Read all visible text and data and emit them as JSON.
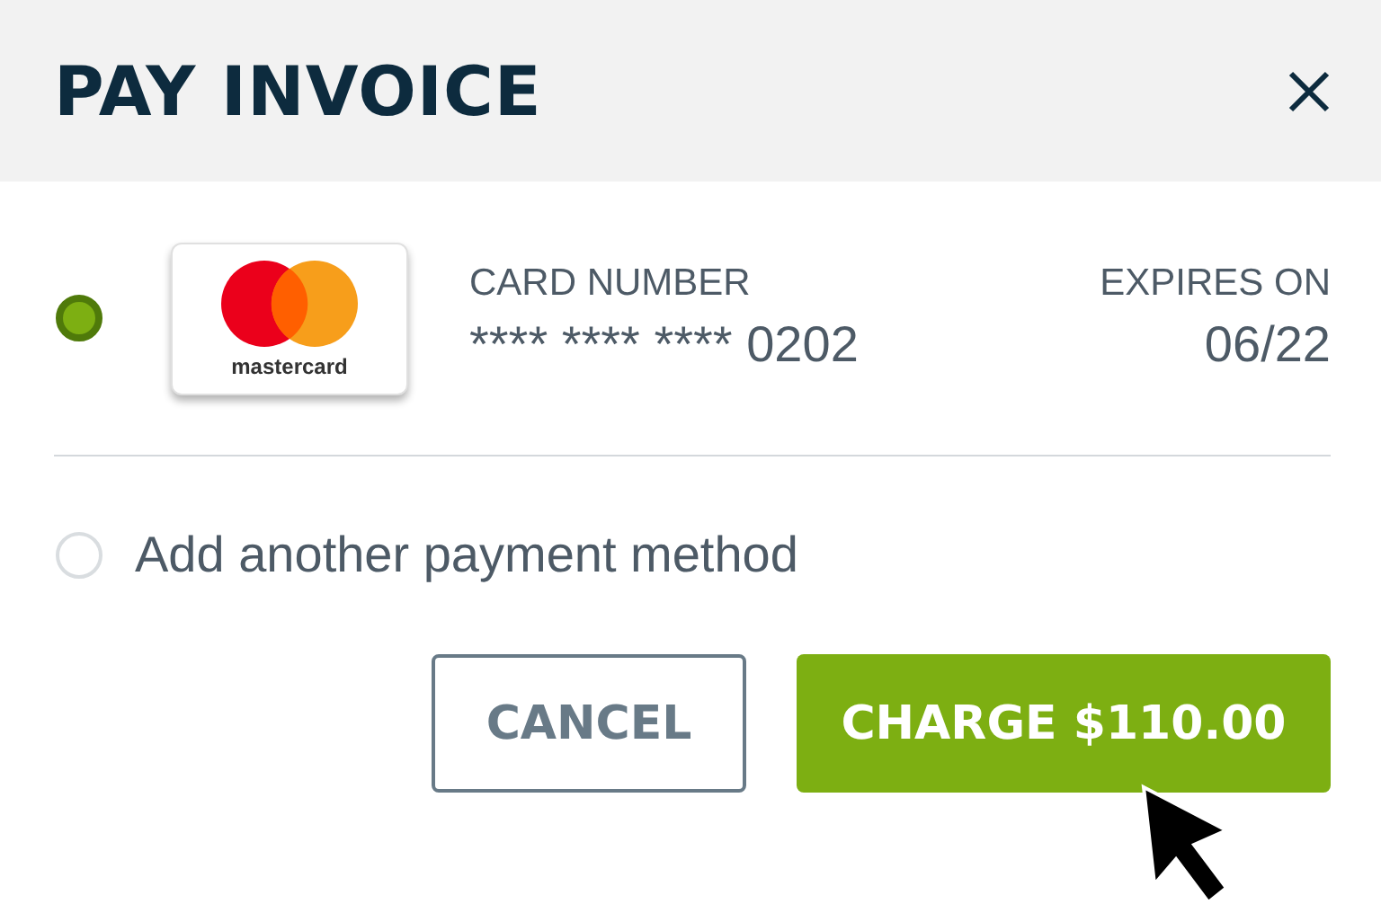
{
  "dialog": {
    "title": "PAY INVOICE"
  },
  "payment_methods": [
    {
      "kind": "card",
      "selected": true,
      "brand": "mastercard",
      "number_label": "CARD NUMBER",
      "number": "**** **** **** 0202",
      "expiry_label": "EXPIRES ON",
      "expiry": "06/22"
    },
    {
      "kind": "add",
      "selected": false,
      "label": "Add another payment method"
    }
  ],
  "buttons": [
    {
      "kind": "secondary",
      "label": "CANCEL"
    },
    {
      "kind": "primary",
      "label": "CHARGE $110.00"
    }
  ]
}
